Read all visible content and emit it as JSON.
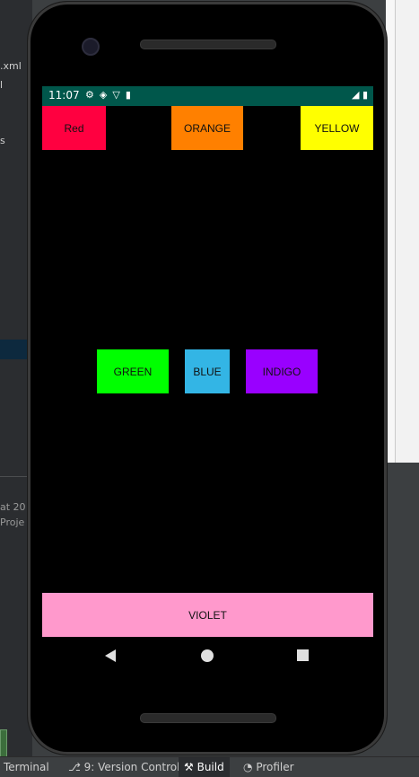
{
  "ide": {
    "left_fragments": [
      ".xml",
      "l",
      "s"
    ],
    "bottom_fragments": [
      "at 20",
      "Proje"
    ],
    "tabs": [
      {
        "label": "Terminal"
      },
      {
        "label": "9: Version Control"
      },
      {
        "label": "Build"
      },
      {
        "label": "Profiler"
      }
    ]
  },
  "status_bar": {
    "time": "11:07"
  },
  "buttons": {
    "red": "Red",
    "orange": "ORANGE",
    "yellow": "YELLOW",
    "green": "GREEN",
    "blue": "BLUE",
    "indigo": "INDIGO",
    "violet": "VIOLET"
  },
  "colors": {
    "red": "#ff0040",
    "orange": "#ff8000",
    "yellow": "#ffff00",
    "green": "#00ff00",
    "blue": "#33b5e5",
    "indigo": "#9900ff",
    "violet": "#ff99cc",
    "status_bar": "#00574b"
  }
}
